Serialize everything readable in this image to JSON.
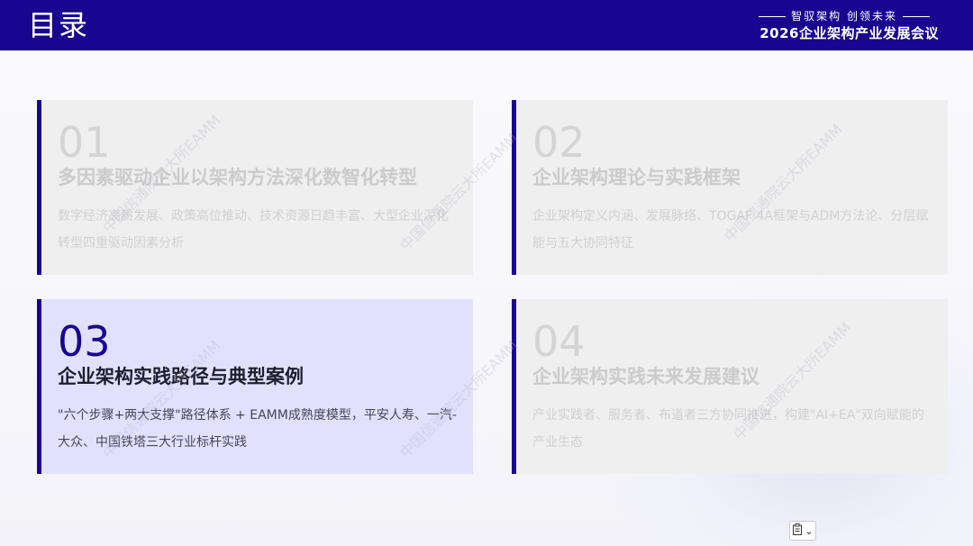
{
  "header": {
    "title": "目录",
    "slogan": "智驭架构  创领未来",
    "conference": "2026企业架构产业发展会议"
  },
  "cards": [
    {
      "num": "01",
      "heading": "多因素驱动企业以架构方法深化数智化转型",
      "desc": "数字经济高质发展、政策高位推动、技术资源日趋丰富、大型企业深化转型四重驱动因素分析",
      "active": false
    },
    {
      "num": "02",
      "heading": "企业架构理论与实践框架",
      "desc": "企业架构定义内涵、发展脉络、TOGAF 4A框架与ADM方法论、分层赋能与五大协同特征",
      "active": false
    },
    {
      "num": "03",
      "heading": "企业架构实践路径与典型案例",
      "desc": "\"六个步骤+两大支撑\"路径体系 + EAMM成熟度模型，平安人寿、一汽-大众、中国铁塔三大行业标杆实践",
      "active": true
    },
    {
      "num": "04",
      "heading": "企业架构实践未来发展建议",
      "desc": "产业实践者、服务者、布道者三方协同推进，构建\"AI+EA\"双向赋能的产业生态",
      "active": false
    }
  ],
  "watermark": "中国信通院云大所EAMM",
  "colors": {
    "brand": "#1a0590",
    "card_bg": "#efefef",
    "card_active_bg": "#e1e1fd"
  },
  "icons": {
    "clipboard": "clipboard-icon",
    "dropdown": "chevron-down-icon"
  }
}
